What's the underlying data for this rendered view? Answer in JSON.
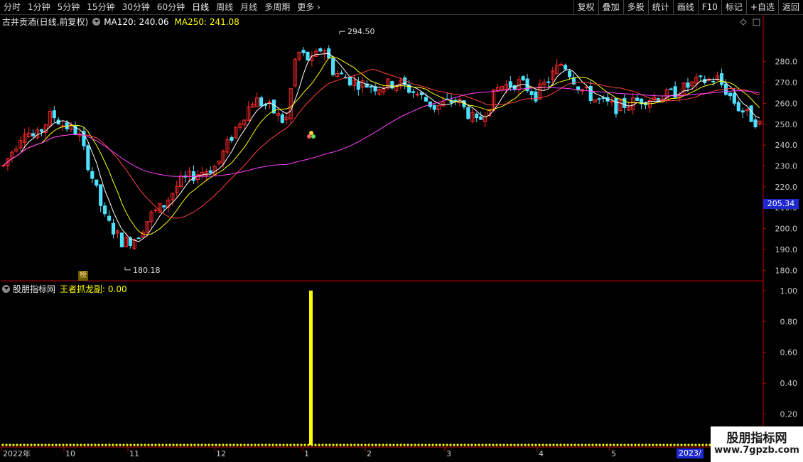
{
  "toolbar": {
    "periods": [
      "分时",
      "1分钟",
      "5分钟",
      "15分钟",
      "30分钟",
      "60分钟",
      "日线",
      "周线",
      "月线",
      "多周期",
      "更多"
    ],
    "active_period": "日线",
    "buttons": [
      "复权",
      "叠加",
      "多股",
      "统计",
      "画线",
      "F10",
      "标记",
      "+自选",
      "返回"
    ]
  },
  "main": {
    "stock_name": "古井贡酒(日线,前复权)",
    "ma120_label": "MA120: 240.06",
    "ma250_label": "MA250: 241.08",
    "high_label": "294.50",
    "low_label": "180.18",
    "current_price": "205.34",
    "bang_badge": "榜",
    "price_ticks": [
      "280.0",
      "270.0",
      "260.0",
      "250.0",
      "240.0",
      "230.0",
      "220.0",
      "210.0",
      "200.0",
      "190.0",
      "180.0"
    ]
  },
  "sub": {
    "indicator_group": "股朋指标网",
    "indicator_label": "王者抓龙副: 0.00",
    "value_ticks": [
      "1.00",
      "0.80",
      "0.60",
      "0.40",
      "0.20"
    ]
  },
  "dates": [
    "2022年",
    "10",
    "11",
    "12",
    "1",
    "2",
    "3",
    "4",
    "5",
    "2023/"
  ],
  "watermark": {
    "line1": "股朋指标网",
    "line2": "www.7gpzb.com"
  },
  "colors": {
    "up": "#ff2a2a",
    "down": "#4fe0ff",
    "ma5": "#ffffff",
    "ma10": "#ffff00",
    "ma20": "#ff4040",
    "ma60": "#ff40ff",
    "signal": "#ffff00",
    "axis": "#c00000"
  },
  "chart_data": {
    "type": "candlestick",
    "y_range": [
      175,
      300
    ],
    "sub_range": [
      0,
      1.05
    ],
    "signal_index": 106,
    "signal_value": 1.0
  }
}
